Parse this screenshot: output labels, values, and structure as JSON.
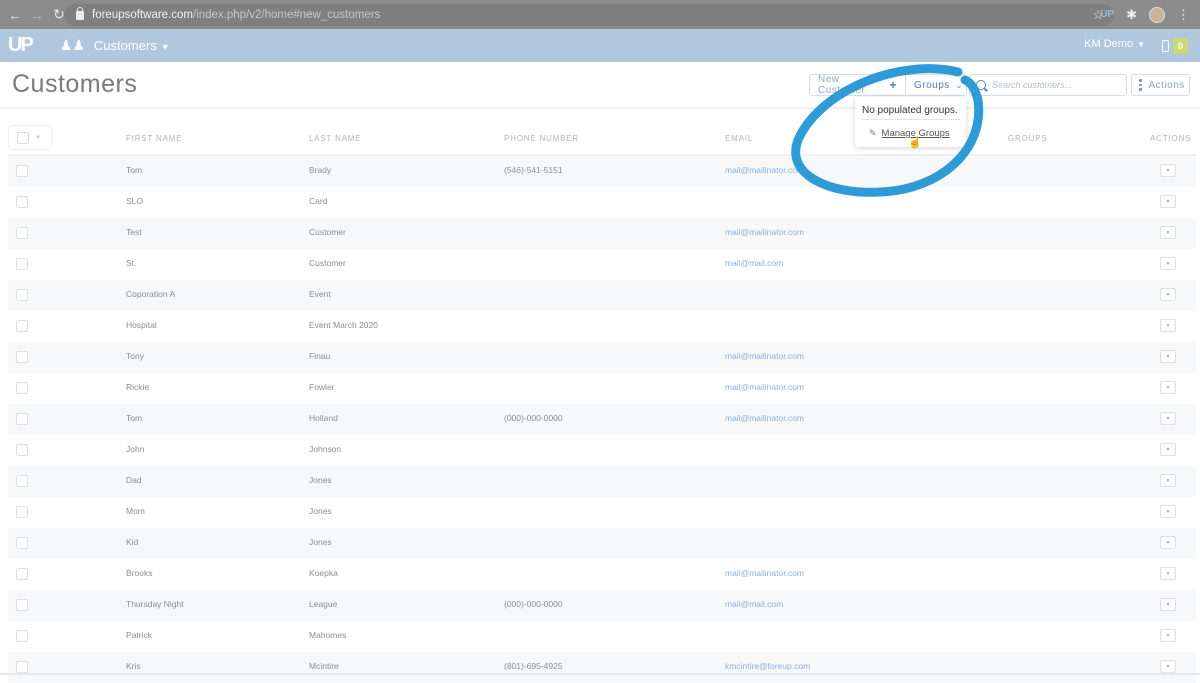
{
  "browser": {
    "url_domain": "foreupsoftware.com",
    "url_path": "/index.php/v2/home#new_customers",
    "extension_label": "UP"
  },
  "appbar": {
    "logo": "UP",
    "module": "Customers",
    "user": "KM Demo",
    "notification_count": "0"
  },
  "page": {
    "title": "Customers"
  },
  "toolbar": {
    "new_customer": "New Customer",
    "groups": "Groups",
    "search_placeholder": "Search customers...",
    "actions": "Actions"
  },
  "groups_dropdown": {
    "empty_text": "No populated groups.",
    "manage_label": "Manage Groups"
  },
  "table": {
    "columns": [
      "FIRST NAME",
      "LAST NAME",
      "PHONE NUMBER",
      "EMAIL",
      "GROUPS",
      "ACTIONS"
    ],
    "rows": [
      {
        "first": "Tom",
        "last": "Brady",
        "phone": "(546)-541-5151",
        "email": "mail@mailinator.com",
        "groups": ""
      },
      {
        "first": "SLO",
        "last": "Card",
        "phone": "",
        "email": "",
        "groups": ""
      },
      {
        "first": "Test",
        "last": "Customer",
        "phone": "",
        "email": "mail@mailinator.com",
        "groups": ""
      },
      {
        "first": "St.",
        "last": "Customer",
        "phone": "",
        "email": "mail@mail.com",
        "groups": ""
      },
      {
        "first": "Coporation A",
        "last": "Event",
        "phone": "",
        "email": "",
        "groups": ""
      },
      {
        "first": "Hospital",
        "last": "Event March 2020",
        "phone": "",
        "email": "",
        "groups": ""
      },
      {
        "first": "Tony",
        "last": "Finau",
        "phone": "",
        "email": "mail@mailinator.com",
        "groups": ""
      },
      {
        "first": "Rickie",
        "last": "Fowler",
        "phone": "",
        "email": "mail@mailinator.com",
        "groups": ""
      },
      {
        "first": "Tom",
        "last": "Holland",
        "phone": "(000)-000-0000",
        "email": "mail@mailinator.com",
        "groups": ""
      },
      {
        "first": "John",
        "last": "Johnson",
        "phone": "",
        "email": "",
        "groups": ""
      },
      {
        "first": "Dad",
        "last": "Jones",
        "phone": "",
        "email": "",
        "groups": ""
      },
      {
        "first": "Mom",
        "last": "Jones",
        "phone": "",
        "email": "",
        "groups": ""
      },
      {
        "first": "Kid",
        "last": "Jones",
        "phone": "",
        "email": "",
        "groups": ""
      },
      {
        "first": "Brooks",
        "last": "Koepka",
        "phone": "",
        "email": "mail@mailinator.com",
        "groups": ""
      },
      {
        "first": "Thursday Night",
        "last": "League",
        "phone": "(000)-000-0000",
        "email": "mail@mail.com",
        "groups": ""
      },
      {
        "first": "Patrick",
        "last": "Mahomes",
        "phone": "",
        "email": "",
        "groups": ""
      },
      {
        "first": "Kris",
        "last": "Mcintire",
        "phone": "(801)-695-4925",
        "email": "kmcintire@foreup.com",
        "groups": ""
      }
    ]
  },
  "colors": {
    "appbar": "#b1c7dd",
    "accent": "#4a78b4",
    "email_link": "#8cb0da",
    "annotation": "#2e9bd6"
  }
}
